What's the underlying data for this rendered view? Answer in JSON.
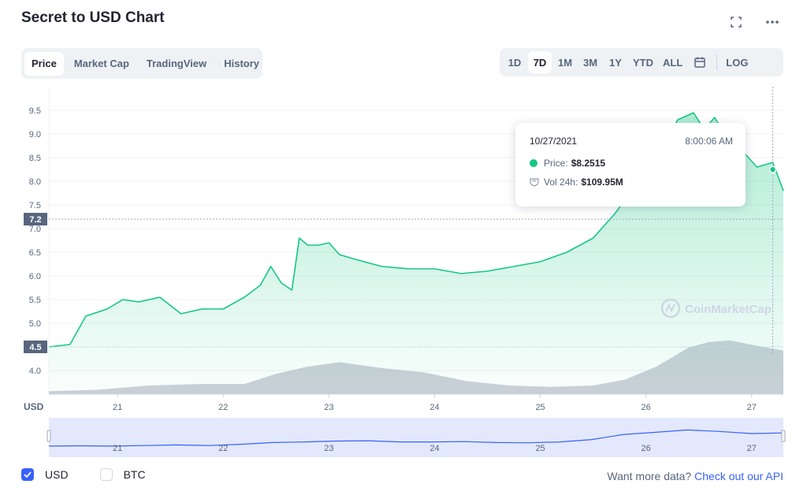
{
  "header": {
    "title": "Secret to USD Chart",
    "fullscreen_icon": "fullscreen-icon",
    "more_icon": "more-horizontal-icon"
  },
  "tabs": [
    {
      "label": "Price",
      "active": true
    },
    {
      "label": "Market Cap",
      "active": false
    },
    {
      "label": "TradingView",
      "active": false
    },
    {
      "label": "History",
      "active": false
    }
  ],
  "ranges": {
    "items": [
      {
        "label": "1D",
        "active": false
      },
      {
        "label": "7D",
        "active": true
      },
      {
        "label": "1M",
        "active": false
      },
      {
        "label": "3M",
        "active": false
      },
      {
        "label": "1Y",
        "active": false
      },
      {
        "label": "YTD",
        "active": false
      },
      {
        "label": "ALL",
        "active": false
      }
    ],
    "calendar_icon": "calendar-icon",
    "log_label": "LOG"
  },
  "chart_data": {
    "type": "area",
    "yticks": [
      "9.5",
      "9.0",
      "8.5",
      "8.0",
      "7.5",
      "7.0",
      "6.5",
      "6.0",
      "5.5",
      "5.0",
      "4.5",
      "4.0"
    ],
    "ylim": [
      3.5,
      10.0
    ],
    "x_axis_label": "USD",
    "xticks": [
      "21",
      "22",
      "23",
      "24",
      "25",
      "26",
      "27"
    ],
    "x": [
      20.35,
      20.55,
      20.7,
      20.9,
      21.05,
      21.2,
      21.4,
      21.6,
      21.8,
      22.0,
      22.2,
      22.35,
      22.45,
      22.55,
      22.65,
      22.72,
      22.8,
      22.9,
      23.0,
      23.1,
      23.25,
      23.5,
      23.75,
      24.0,
      24.25,
      24.5,
      24.75,
      25.0,
      25.25,
      25.5,
      25.7,
      25.8,
      25.9,
      26.0,
      26.15,
      26.3,
      26.45,
      26.55,
      26.65,
      26.75,
      26.85,
      26.95,
      27.05,
      27.2,
      27.3
    ],
    "values": [
      4.5,
      4.55,
      5.15,
      5.3,
      5.5,
      5.45,
      5.55,
      5.2,
      5.3,
      5.3,
      5.55,
      5.8,
      6.2,
      5.85,
      5.7,
      6.8,
      6.65,
      6.65,
      6.7,
      6.45,
      6.35,
      6.2,
      6.15,
      6.15,
      6.05,
      6.1,
      6.2,
      6.3,
      6.5,
      6.8,
      7.3,
      7.6,
      8.0,
      8.3,
      8.7,
      9.3,
      9.45,
      9.1,
      9.35,
      9.0,
      8.7,
      8.55,
      8.3,
      8.4,
      7.8
    ],
    "volume_x": [
      20.35,
      20.8,
      21.3,
      21.8,
      22.2,
      22.5,
      22.8,
      23.1,
      23.5,
      23.9,
      24.3,
      24.7,
      25.1,
      25.5,
      25.8,
      26.1,
      26.4,
      26.6,
      26.8,
      27.0,
      27.3
    ],
    "volume": [
      0.04,
      0.06,
      0.12,
      0.14,
      0.14,
      0.28,
      0.38,
      0.44,
      0.36,
      0.3,
      0.18,
      0.12,
      0.1,
      0.12,
      0.2,
      0.38,
      0.64,
      0.72,
      0.74,
      0.68,
      0.6
    ],
    "xlim": [
      20.35,
      27.3
    ],
    "markers": {
      "current_price_label": "7.2",
      "current_price": 7.2,
      "open_price_label": "4.5",
      "open_price": 4.5,
      "hover_x": 27.2
    },
    "watermark": "CoinMarketCap",
    "colors": {
      "line": "#16c784",
      "volume": "#c3c8d1",
      "navigator_line": "#3861fb",
      "navigator_bg": "#e3e8fd"
    }
  },
  "navigator": {
    "values": [
      0.16,
      0.17,
      0.16,
      0.18,
      0.2,
      0.18,
      0.22,
      0.28,
      0.3,
      0.33,
      0.34,
      0.3,
      0.3,
      0.31,
      0.28,
      0.27,
      0.3,
      0.38,
      0.55,
      0.62,
      0.7,
      0.65,
      0.58,
      0.6
    ]
  },
  "tooltip": {
    "date": "10/27/2021",
    "time": "8:00:06 AM",
    "price_label": "Price:",
    "price_value": "$8.2515",
    "vol_label": "Vol 24h:",
    "vol_value": "$109.95M",
    "vol_icon": "shield-icon"
  },
  "footer": {
    "usd_label": "USD",
    "usd_checked": true,
    "btc_label": "BTC",
    "btc_checked": false,
    "more_data_text": "Want more data?",
    "api_link": "Check out our API"
  }
}
